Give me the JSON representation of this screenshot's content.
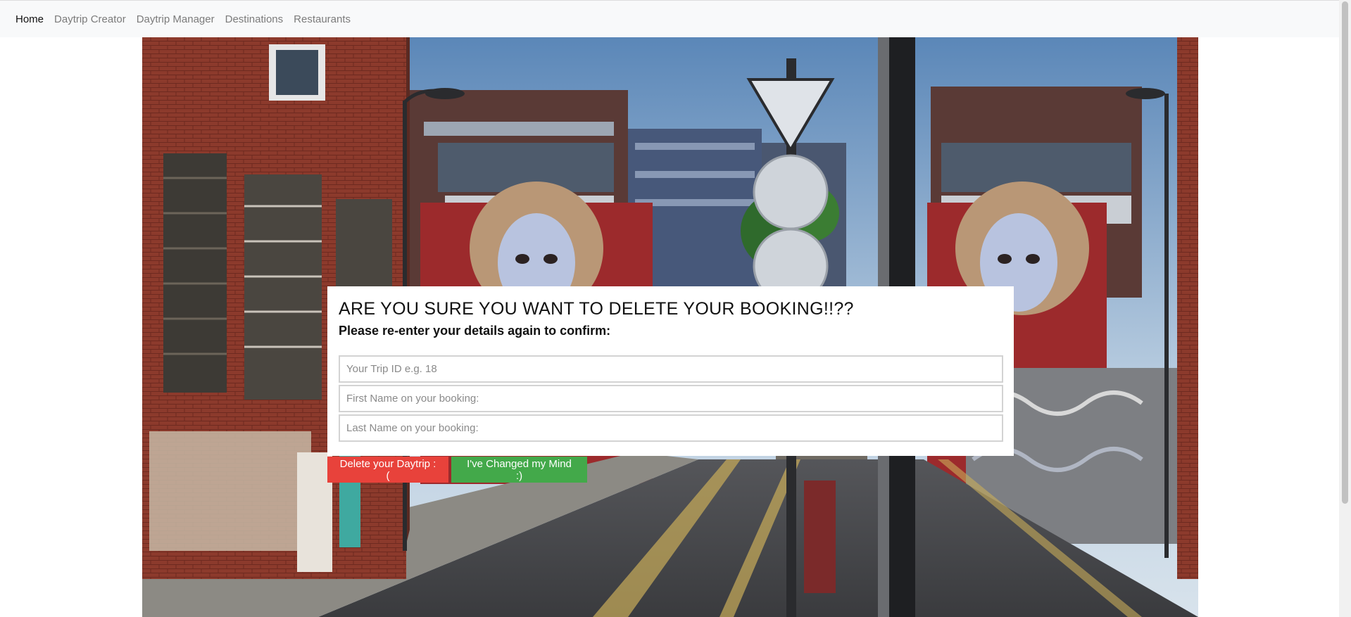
{
  "nav": {
    "items": [
      {
        "label": "Home",
        "active": true
      },
      {
        "label": "Daytrip Creator",
        "active": false
      },
      {
        "label": "Daytrip Manager",
        "active": false
      },
      {
        "label": "Destinations",
        "active": false
      },
      {
        "label": "Restaurants",
        "active": false
      }
    ]
  },
  "dialog": {
    "title": "ARE YOU SURE YOU WANT TO DELETE YOUR BOOKING!!??",
    "subtitle": "Please re-enter your details again to confirm:",
    "trip_id_placeholder": "Your Trip ID e.g. 18",
    "first_name_placeholder": "First Name on your booking:",
    "last_name_placeholder": "Last Name on your booking:"
  },
  "buttons": {
    "delete_label": "Delete your Daytrip :(",
    "cancel_label": "I've Changed my Mind :)"
  },
  "colors": {
    "delete": "#e8423b",
    "cancel": "#43a94a",
    "navbar": "#f8f9fa"
  }
}
